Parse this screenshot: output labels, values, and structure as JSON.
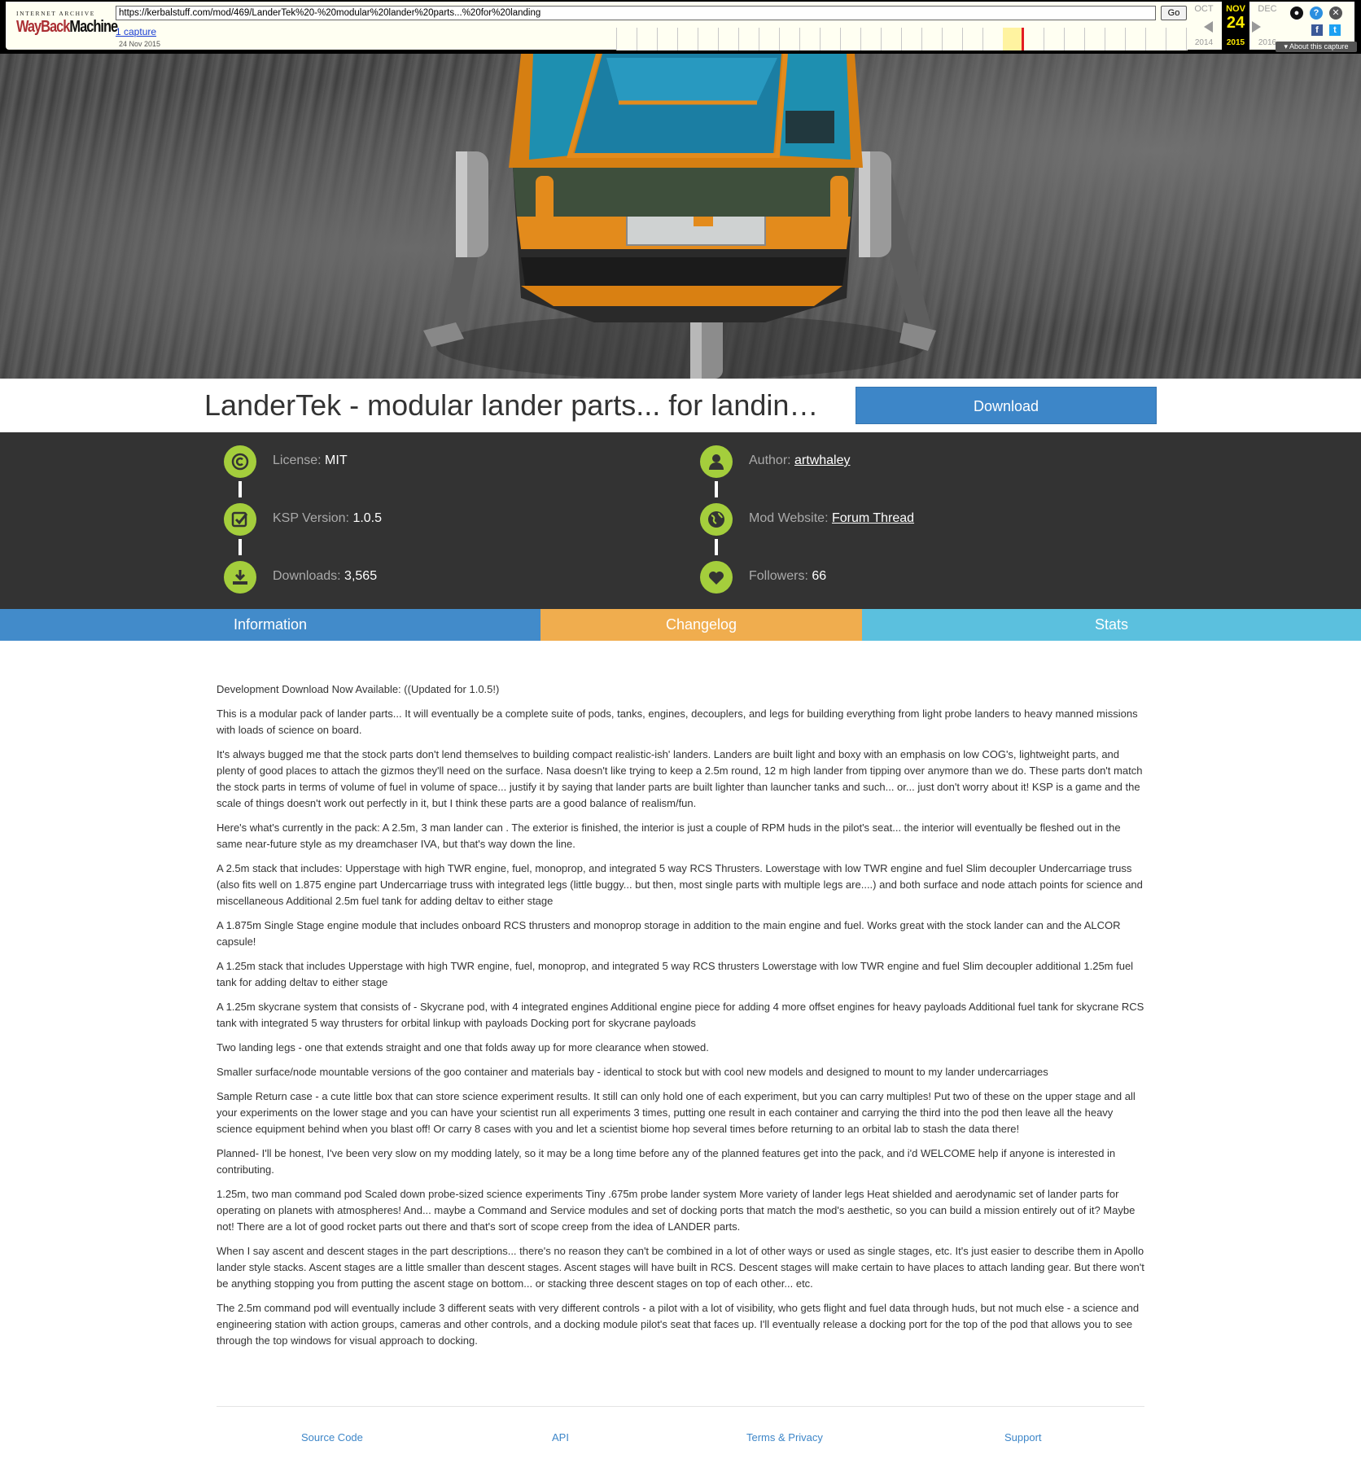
{
  "wayback": {
    "logo_top": "INTERNET ARCHIVE",
    "logo_wayback": "WayBack",
    "logo_machine": "Machine",
    "url": "https://kerbalstuff.com/mod/469/LanderTek%20-%20modular%20lander%20parts...%20for%20landing",
    "go_label": "Go",
    "captures_link": "1 capture",
    "capture_date": "24 Nov 2015",
    "months": [
      {
        "month": "OCT",
        "day": "",
        "year": "2014"
      },
      {
        "month": "NOV",
        "day": "24",
        "year": "2015"
      },
      {
        "month": "DEC",
        "day": "",
        "year": "2016"
      }
    ],
    "about_label": "▾ About this capture",
    "colors": {
      "accent": "#ffeb00",
      "logo_red": "#ab2e33",
      "capture_mark": "#e21c24"
    }
  },
  "mod": {
    "title": "LanderTek - modular lander parts... for landin…",
    "download_label": "Download"
  },
  "info": {
    "license": {
      "label": "License: ",
      "value": "MIT",
      "icon": "copyright-icon"
    },
    "ksp_version": {
      "label": "KSP Version: ",
      "value": "1.0.5",
      "icon": "checkbox-icon"
    },
    "downloads": {
      "label": "Downloads: ",
      "value": "3,565",
      "icon": "download-icon"
    },
    "author": {
      "label": "Author: ",
      "value": "artwhaley",
      "icon": "user-icon"
    },
    "website": {
      "label": "Mod Website: ",
      "value": "Forum Thread",
      "icon": "globe-icon"
    },
    "followers": {
      "label": "Followers: ",
      "value": "66",
      "icon": "heart-icon"
    }
  },
  "tabs": [
    {
      "label": "Information",
      "color": "#428bca"
    },
    {
      "label": "Changelog",
      "color": "#f0ad4e"
    },
    {
      "label": "Stats",
      "color": "#5bc0de"
    }
  ],
  "description": [
    "Development Download Now Available: ((Updated for 1.0.5!)",
    "This is a modular pack of lander parts... It will eventually be a complete suite of pods, tanks, engines, decouplers, and legs for building everything from light probe landers to heavy manned missions with loads of science on board.",
    "It's always bugged me that the stock parts don't lend themselves to building compact realistic-ish' landers. Landers are built light and boxy with an emphasis on low COG's, lightweight parts, and plenty of good places to attach the gizmos they'll need on the surface. Nasa doesn't like trying to keep a 2.5m round, 12 m high lander from tipping over anymore than we do. These parts don't match the stock parts in terms of volume of fuel in volume of space... justify it by saying that lander parts are built lighter than launcher tanks and such... or... just don't worry about it! KSP is a game and the scale of things doesn't work out perfectly in it, but I think these parts are a good balance of realism/fun.",
    "Here's what's currently in the pack: A 2.5m, 3 man lander can . The exterior is finished, the interior is just a couple of RPM huds in the pilot's seat... the interior will eventually be fleshed out in the same near-future style as my dreamchaser IVA, but that's way down the line.",
    "A 2.5m stack that includes: Upperstage with high TWR engine, fuel, monoprop, and integrated 5 way RCS Thrusters. Lowerstage with low TWR engine and fuel Slim decoupler Undercarriage truss (also fits well on 1.875 engine part Undercarriage truss with integrated legs (little buggy... but then, most single parts with multiple legs are....) and both surface and node attach points for science and miscellaneous Additional 2.5m fuel tank for adding deltav to either stage",
    "A 1.875m Single Stage engine module that includes onboard RCS thrusters and monoprop storage in addition to the main engine and fuel. Works great with the stock lander can and the ALCOR capsule!",
    "A 1.25m stack that includes Upperstage with high TWR engine, fuel, monoprop, and integrated 5 way RCS thrusters Lowerstage with low TWR engine and fuel Slim decoupler additional 1.25m fuel tank for adding deltav to either stage",
    "A 1.25m skycrane system that consists of - Skycrane pod, with 4 integrated engines Additional engine piece for adding 4 more offset engines for heavy payloads Additional fuel tank for skycrane RCS tank with integrated 5 way thrusters for orbital linkup with payloads Docking port for skycrane payloads",
    "Two landing legs - one that extends straight and one that folds away up for more clearance when stowed.",
    "Smaller surface/node mountable versions of the goo container and materials bay - identical to stock but with cool new models and designed to mount to my lander undercarriages",
    "Sample Return case - a cute little box that can store science experiment results. It still can only hold one of each experiment, but you can carry multiples! Put two of these on the upper stage and all your experiments on the lower stage and you can have your scientist run all experiments 3 times, putting one result in each container and carrying the third into the pod then leave all the heavy science equipment behind when you blast off! Or carry 8 cases with you and let a scientist biome hop several times before returning to an orbital lab to stash the data there!",
    "Planned- I'll be honest, I've been very slow on my modding lately, so it may be a long time before any of the planned features get into the pack, and i'd WELCOME help if anyone is interested in contributing.",
    "1.25m, two man command pod Scaled down probe-sized science experiments Tiny .675m probe lander system More variety of lander legs Heat shielded and aerodynamic set of lander parts for operating on planets with atmospheres! And... maybe a Command and Service modules and set of docking ports that match the mod's aesthetic, so you can build a mission entirely out of it? Maybe not! There are a lot of good rocket parts out there and that's sort of scope creep from the idea of LANDER parts.",
    "When I say ascent and descent stages in the part descriptions... there's no reason they can't be combined in a lot of other ways or used as single stages, etc. It's just easier to describe them in Apollo lander style stacks. Ascent stages are a little smaller than descent stages. Ascent stages will have built in RCS. Descent stages will make certain to have places to attach landing gear. But there won't be anything stopping you from putting the ascent stage on bottom... or stacking three descent stages on top of each other... etc.",
    "The 2.5m command pod will eventually include 3 different seats with very different controls - a pilot with a lot of visibility, who gets flight and fuel data through huds, but not much else - a science and engineering station with action groups, cameras and other controls, and a docking module pilot's seat that faces up. I'll eventually release a docking port for the top of the pod that allows you to see through the top windows for visual approach to docking."
  ],
  "footer": {
    "source_code": "Source Code",
    "api": "API",
    "terms": "Terms & Privacy",
    "support": "Support"
  },
  "colors": {
    "download_button": "#3d86c8",
    "info_panel_bg": "#333333",
    "icon_green": "#a4ce3c",
    "link_blue": "#3d86c8"
  }
}
